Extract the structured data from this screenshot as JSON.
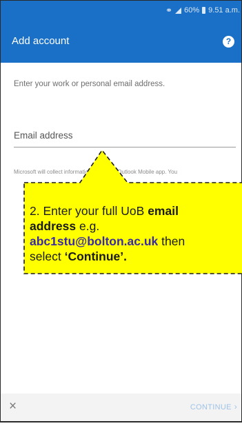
{
  "status_bar": {
    "battery": "60%",
    "time": "9.51 a.m."
  },
  "app_bar": {
    "title": "Add account",
    "help_icon": "?"
  },
  "content": {
    "instruction": "Enter your work or personal email address.",
    "email_placeholder": "Email address",
    "email_value": "",
    "privacy_text": "Microsoft will collect information about the Outlook Mobile app. You"
  },
  "callout": {
    "line1_prefix": "2. Enter your full UoB ",
    "line1_bold": "email",
    "line2_bold": "address",
    "line2_suffix": " e.g.",
    "line3_email": "abc1stu@bolton.ac.uk",
    "line3_suffix": " then",
    "line4_prefix": "select ",
    "line4_bold": "‘Continue’.",
    "fill_color": "#ffff00",
    "accent_color": "#3a2aa3"
  },
  "bottom_bar": {
    "close_icon": "×",
    "continue_label": "CONTINUE",
    "chevron_icon": "›"
  },
  "colors": {
    "brand_blue": "#1a6fc6",
    "callout_yellow": "#ffff00"
  }
}
